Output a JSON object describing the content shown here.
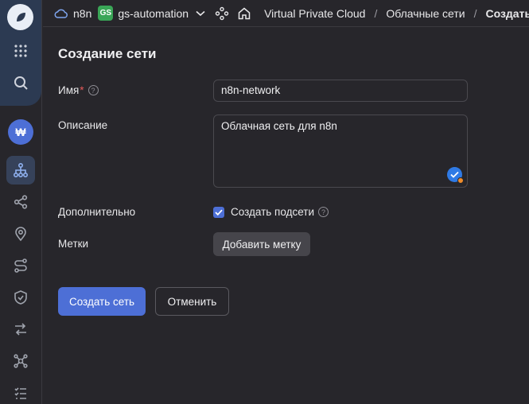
{
  "header": {
    "project": "n8n",
    "folder_badge": "GS",
    "folder": "gs-automation",
    "breadcrumbs": [
      "Virtual Private Cloud",
      "Облачные сети",
      "Создать"
    ],
    "separator": "/"
  },
  "sidebar": {
    "avatar_letter": "₩",
    "icons": [
      "grid-icon",
      "search-icon",
      "network-icon",
      "share-icon",
      "location-icon",
      "route-icon",
      "shield-icon",
      "arrows-icon",
      "graph-icon",
      "list-icon"
    ]
  },
  "form": {
    "title": "Создание сети",
    "name_label": "Имя",
    "name_required_mark": "*",
    "name_value": "n8n-network",
    "description_label": "Описание",
    "description_value": "Облачная сеть для n8n",
    "additional_label": "Дополнительно",
    "create_subnets_label": "Создать подсети",
    "create_subnets_checked": true,
    "labels_label": "Метки",
    "add_label_button": "Добавить метку",
    "help_glyph": "?"
  },
  "actions": {
    "create_button": "Создать сеть",
    "cancel_button": "Отменить"
  },
  "colors": {
    "accent": "#4d6fd6",
    "background": "#27262b",
    "required": "#e55a5a"
  }
}
